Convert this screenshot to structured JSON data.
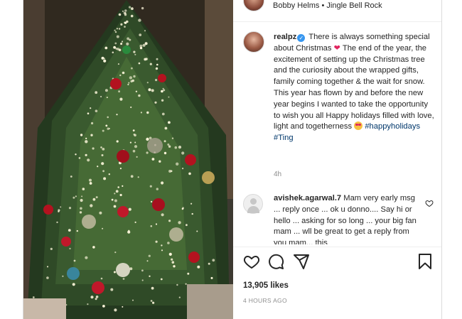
{
  "music": {
    "artist": "Bobby Helms",
    "separator": " • ",
    "song": "Jingle Bell Rock"
  },
  "caption": {
    "username": "realpz",
    "text_1": "There is always something special about Christmas",
    "text_2": "The end of the year, the excitement of setting up the Christmas tree and the curiosity about the wrapped gifts, family coming together & the wait for snow. This year has flown by and before the new year begins I wanted to take the opportunity to wish you all Happy holidays filled with love, light and togetherness",
    "hashtag_1": "#happyholidays",
    "hashtag_2": "#Ting",
    "time": "4h"
  },
  "comment": {
    "username": "avishek.agarwal.7",
    "text": "Mam very early msg ... reply once ... ok u donno.... Say hi or hello ... asking for so long ... your big fan mam ... wll be great to get a reply from you mam... this"
  },
  "likes_text": "13,905 likes",
  "timestamp": "4 HOURS AGO",
  "icons": {
    "like": "heart-outline-icon",
    "comment": "comment-bubble-icon",
    "share": "paper-plane-icon",
    "save": "bookmark-icon",
    "verified": "verified-badge-icon"
  },
  "colors": {
    "hashtag": "#00376b",
    "verified": "#3897f0",
    "heart": "#e0245e",
    "secondary_text": "#8e8e8e"
  }
}
